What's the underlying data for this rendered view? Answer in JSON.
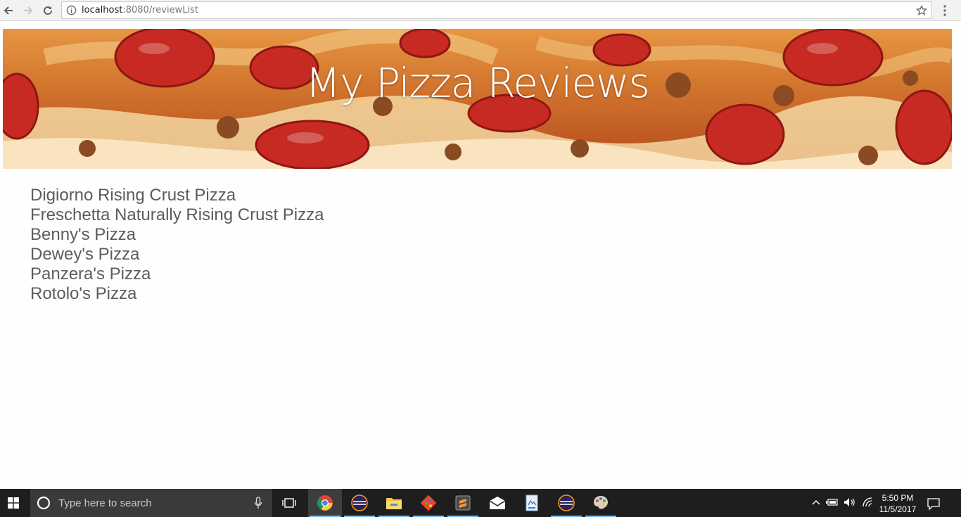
{
  "browser": {
    "url_host": "localhost",
    "url_path": ":8080/reviewList"
  },
  "banner": {
    "title": "My Pizza Reviews"
  },
  "reviews": [
    "Digiorno Rising Crust Pizza",
    "Freschetta Naturally Rising Crust Pizza",
    "Benny's Pizza",
    "Dewey's Pizza",
    "Panzera's Pizza",
    "Rotolo's Pizza"
  ],
  "taskbar": {
    "search_placeholder": "Type here to search",
    "apps": [
      "chrome-icon",
      "eclipse-icon",
      "file-explorer-icon",
      "git-icon",
      "sublime-text-icon",
      "mail-icon",
      "document-icon",
      "eclipse-icon",
      "paint-icon"
    ],
    "clock_time": "5:50 PM",
    "clock_date": "11/5/2017"
  },
  "colors": {
    "text": "#5c5c5c",
    "taskbar": "#1e1e1e",
    "accent": "#76b9ed"
  }
}
